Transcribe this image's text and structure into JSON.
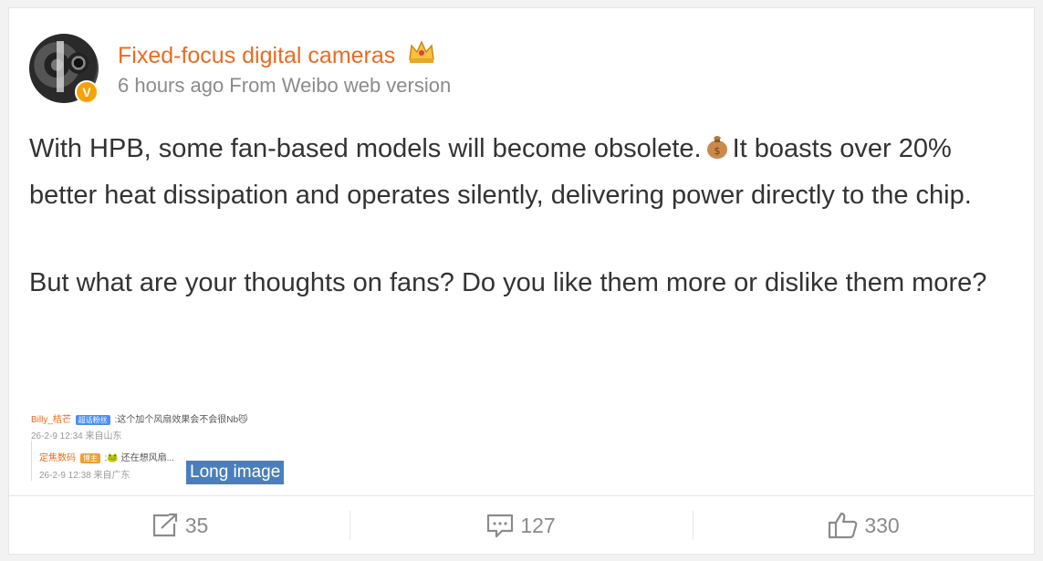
{
  "post": {
    "username": "Fixed-focus digital cameras",
    "meta": "6 hours ago From Weibo web version",
    "verified_badge": "V",
    "paragraph1_a": "With HPB, some fan-based models will become obsolete.",
    "paragraph1_b": "It boasts over 20% better heat dissipation and operates silently, delivering power directly to the chip.",
    "paragraph2": "But what are your thoughts on fans? Do you like them more or dislike them more?",
    "icons": {
      "crown": "crown-emoji-icon",
      "bag": "money-bag-emoji-icon"
    }
  },
  "attachment": {
    "comment1_user": "Billy_桔芒",
    "comment1_tag": "超话粉丝",
    "comment1_text": ":这个加个风扇效果会不会很Nb😼",
    "comment1_meta": "26-2-9 12:34 来自山东",
    "reply_user": "定焦数码",
    "reply_tag": "博主",
    "reply_text": ":🐸 还在想风扇...",
    "reply_meta": "26-2-9 12:38 来自广东",
    "long_image_label": "Long image"
  },
  "actions": {
    "repost_count": "35",
    "comment_count": "127",
    "like_count": "330"
  },
  "colors": {
    "username": "#ea6b1f",
    "badge": "#4a7fbb",
    "text": "#333333"
  }
}
